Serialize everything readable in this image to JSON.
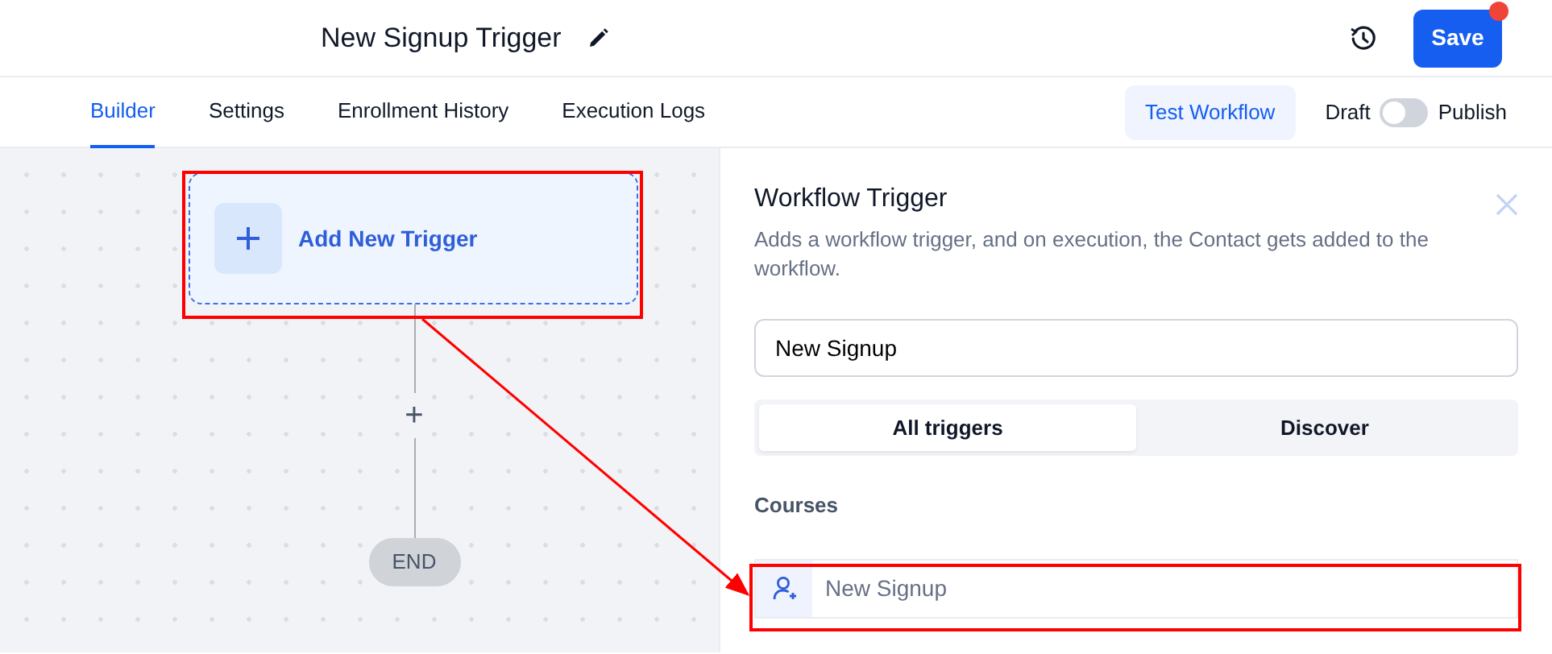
{
  "header": {
    "title": "New Signup Trigger",
    "save_button": "Save",
    "save_notification": true
  },
  "tabs": [
    {
      "label": "Builder",
      "selected": true
    },
    {
      "label": "Settings",
      "selected": false
    },
    {
      "label": "Enrollment History",
      "selected": false
    },
    {
      "label": "Execution Logs",
      "selected": false
    }
  ],
  "test_button": "Test Workflow",
  "publish_toggle": {
    "off_label": "Draft",
    "on_label": "Publish",
    "on": false
  },
  "canvas": {
    "trigger_node": "Add New Trigger",
    "add_step": "+",
    "end_node": "END"
  },
  "panel": {
    "title": "Workflow Trigger",
    "description": "Adds a workflow trigger, and on execution, the Contact gets added to the workflow.",
    "search": {
      "value": "New Signup"
    },
    "segments": [
      {
        "label": "All triggers",
        "selected": true
      },
      {
        "label": "Discover",
        "selected": false
      }
    ],
    "sections": [
      {
        "heading": "Courses",
        "items": [
          {
            "label": "New Signup"
          }
        ]
      }
    ]
  }
}
